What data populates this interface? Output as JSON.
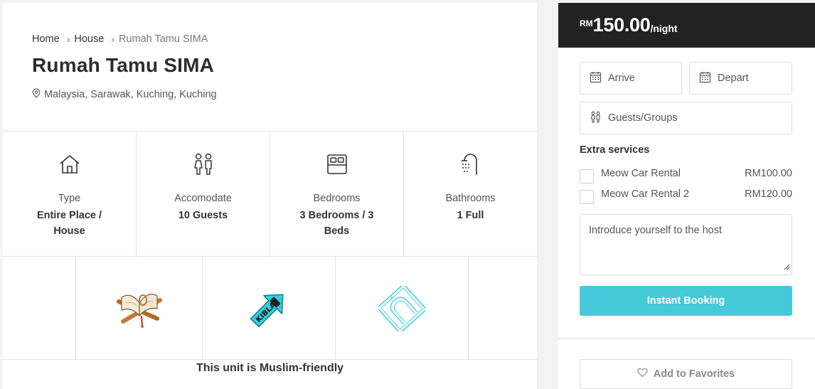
{
  "breadcrumb": {
    "home": "Home",
    "separator": "›",
    "category": "House",
    "current": "Rumah Tamu SIMA"
  },
  "listing": {
    "title": "Rumah Tamu SIMA",
    "location": "Malaysia, Sarawak, Kuching, Kuching",
    "location_icon": "map-pin-icon"
  },
  "features": [
    {
      "icon": "house-icon",
      "label": "Type",
      "value": "Entire Place / House"
    },
    {
      "icon": "guests-icon",
      "label": "Accomodate",
      "value": "10 Guests"
    },
    {
      "icon": "bed-icon",
      "label": "Bedrooms",
      "value": "3 Bedrooms / 3 Beds"
    },
    {
      "icon": "shower-icon",
      "label": "Bathrooms",
      "value": "1 Full"
    }
  ],
  "muslim_friendly": {
    "icons": [
      "quran-stand-icon",
      "kiblat-arrow-icon",
      "prayer-mat-icon"
    ],
    "kiblat_text": "KIBLAT",
    "text": "This unit is Muslim-friendly"
  },
  "booking": {
    "currency": "RM",
    "price": "150.00",
    "per": "/night",
    "arrive_placeholder": "Arrive",
    "depart_placeholder": "Depart",
    "guests_placeholder": "Guests/Groups",
    "extra_services_title": "Extra services",
    "services": [
      {
        "name": "Meow Car Rental",
        "price": "RM100.00",
        "checked": false
      },
      {
        "name": "Meow Car Rental 2",
        "price": "RM120.00",
        "checked": false
      }
    ],
    "message_placeholder": "Introduce yourself to the host",
    "book_label": "Instant Booking",
    "favorite_label": "Add to Favorites"
  },
  "colors": {
    "accent": "#46c9d8",
    "price_bar": "#222222",
    "kiblat_arrow": "#2ed3e0"
  }
}
